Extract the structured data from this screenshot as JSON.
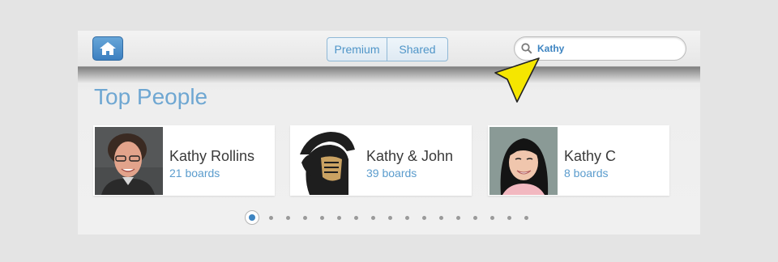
{
  "header": {
    "segments": [
      "Premium",
      "Shared"
    ],
    "search": {
      "value": "Kathy"
    },
    "home_icon": "home-icon",
    "search_icon": "magnifier-icon"
  },
  "section": {
    "title": "Top People"
  },
  "people": [
    {
      "name": "Kathy Rollins",
      "boards": "21 boards"
    },
    {
      "name": "Kathy & John",
      "boards": "39 boards"
    },
    {
      "name": "Kathy C",
      "boards": "8 boards"
    }
  ],
  "pagination": {
    "total": 17,
    "current": 1
  },
  "colors": {
    "accent": "#5b9ccd",
    "pointer": "#f5e600"
  }
}
